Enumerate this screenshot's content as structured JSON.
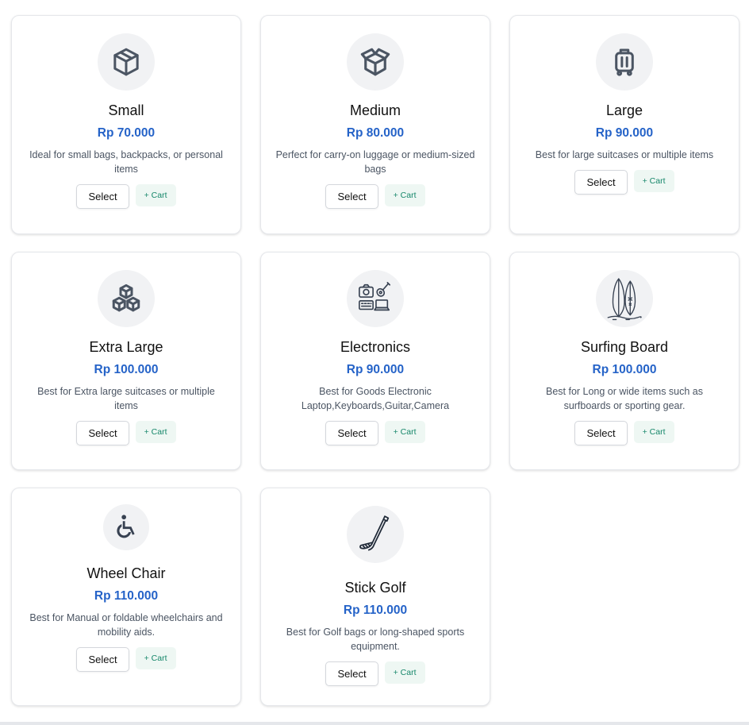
{
  "buttons": {
    "select_label": "Select",
    "cart_label": "+ Cart"
  },
  "colors": {
    "price": "#2563c8",
    "cart_text": "#16876a",
    "cart_bg": "#eef7f3",
    "icon_bg": "#f1f2f4"
  },
  "cards": [
    {
      "title": "Small",
      "price": "Rp 70.000",
      "description": "Ideal for small bags, backpacks, or personal items",
      "icon": "box-icon"
    },
    {
      "title": "Medium",
      "price": "Rp 80.000",
      "description": "Perfect for carry-on luggage or medium-sized bags",
      "icon": "open-box-icon"
    },
    {
      "title": "Large",
      "price": "Rp 90.000",
      "description": "Best for large suitcases or multiple items",
      "icon": "suitcase-icon"
    },
    {
      "title": "Extra Large",
      "price": "Rp 100.000",
      "description": "Best for Extra large suitcases or multiple items",
      "icon": "stacked-boxes-icon"
    },
    {
      "title": "Electronics",
      "price": "Rp 90.000",
      "description": "Best for Goods Electronic Laptop,Keyboards,Guitar,Camera",
      "icon": "electronics-icon"
    },
    {
      "title": "Surfing Board",
      "price": "Rp 100.000",
      "description": "Best for Long or wide items such as surfboards or sporting gear.",
      "icon": "surfboard-icon"
    },
    {
      "title": "Wheel Chair",
      "price": "Rp 110.000",
      "description": "Best for Manual or foldable wheelchairs and mobility aids.",
      "icon": "wheelchair-icon"
    },
    {
      "title": "Stick Golf",
      "price": "Rp 110.000",
      "description": "Best for Golf bags or long-shaped sports equipment.",
      "icon": "golf-club-icon"
    }
  ]
}
